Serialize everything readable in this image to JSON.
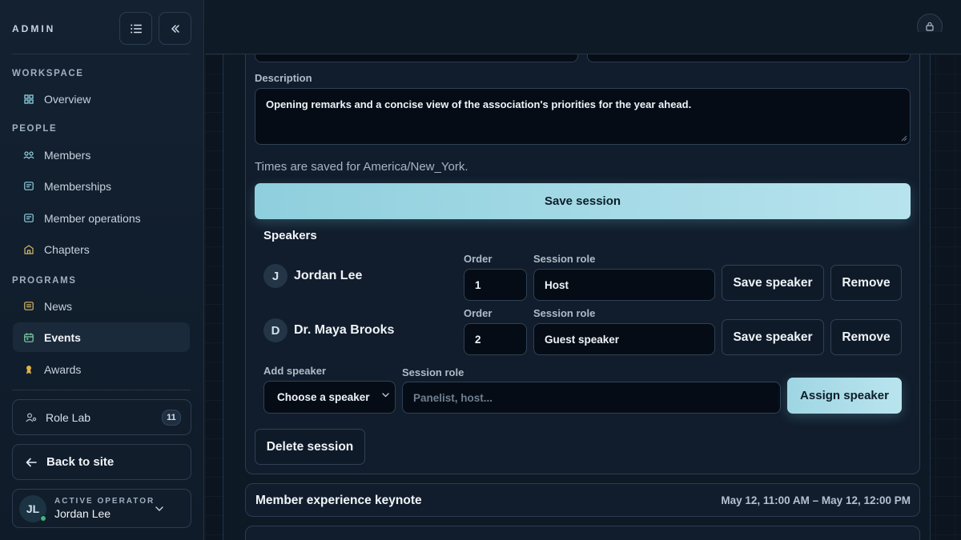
{
  "sidebar": {
    "brand": "ADMIN",
    "sections": {
      "workspace": "WORKSPACE",
      "people": "PEOPLE",
      "programs": "PROGRAMS"
    },
    "items": {
      "overview": "Overview",
      "members": "Members",
      "memberships": "Memberships",
      "member_operations": "Member operations",
      "chapters": "Chapters",
      "news": "News",
      "events": "Events",
      "awards": "Awards"
    },
    "role_lab": {
      "label": "Role Lab",
      "count": "11"
    },
    "back_to_site": "Back to site",
    "operator": {
      "caption": "ACTIVE OPERATOR",
      "name": "Jordan Lee",
      "initials": "JL"
    }
  },
  "session": {
    "description_label": "Description",
    "description_value": "Opening remarks and a concise view of the association's priorities for the year ahead.",
    "timezone_hint": "Times are saved for America/New_York.",
    "save_label": "Save session",
    "delete_label": "Delete session"
  },
  "speakers": {
    "heading": "Speakers",
    "order_label": "Order",
    "role_label": "Session role",
    "save_label": "Save speaker",
    "remove_label": "Remove",
    "list": [
      {
        "initial": "J",
        "name": "Jordan Lee",
        "order": "1",
        "role": "Host"
      },
      {
        "initial": "D",
        "name": "Dr. Maya Brooks",
        "order": "2",
        "role": "Guest speaker"
      }
    ],
    "add": {
      "label": "Add speaker",
      "select_value": "Choose a speaker",
      "role_label": "Session role",
      "role_placeholder": "Panelist, host...",
      "assign_label": "Assign speaker"
    }
  },
  "other_sessions": [
    {
      "title": "Member experience keynote",
      "time": "May 12, 11:00 AM – May 12, 12:00 PM"
    }
  ],
  "colors": {
    "accent": "#9fd6e3",
    "sidebar_bg": "#132131",
    "page_bg": "#0b141f",
    "status_online": "#3fb67a"
  }
}
